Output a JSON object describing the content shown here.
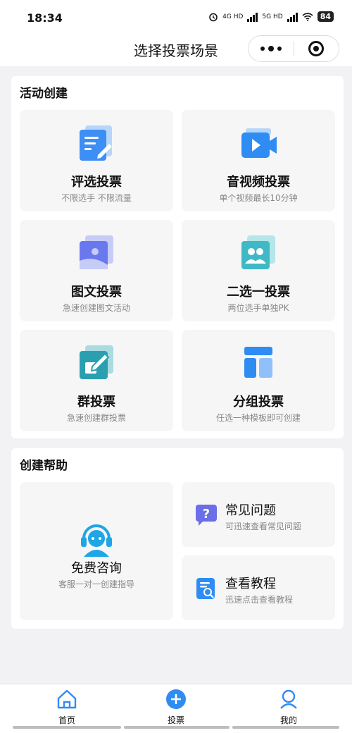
{
  "status": {
    "time": "18:34",
    "net1": "4G HD",
    "net2": "5G HD",
    "battery": "84"
  },
  "nav": {
    "title": "选择投票场景",
    "more_icon": "more-dots-icon",
    "close_icon": "target-circle-icon"
  },
  "create": {
    "title": "活动创建",
    "cards": [
      {
        "title": "评选投票",
        "sub": "不限选手 不限流量",
        "icon": "document-edit-icon"
      },
      {
        "title": "音视频投票",
        "sub": "单个视频最长10分钟",
        "icon": "video-camera-icon"
      },
      {
        "title": "图文投票",
        "sub": "急速创建图文活动",
        "icon": "image-icon"
      },
      {
        "title": "二选一投票",
        "sub": "两位选手单独PK",
        "icon": "two-users-icon"
      },
      {
        "title": "群投票",
        "sub": "急速创建群投票",
        "icon": "group-edit-icon"
      },
      {
        "title": "分组投票",
        "sub": "任选一种模板即可创建",
        "icon": "layout-grid-icon"
      }
    ]
  },
  "help": {
    "title": "创建帮助",
    "consult": {
      "title": "免费咨询",
      "sub": "客服一对一创建指导",
      "icon": "headset-icon"
    },
    "faq": {
      "title": "常见问题",
      "sub": "可迅速查看常见问题",
      "icon": "question-bubble-icon"
    },
    "tutorial": {
      "title": "查看教程",
      "sub": "迅速点击查看教程",
      "icon": "search-doc-icon"
    }
  },
  "tabs": [
    {
      "label": "首页",
      "icon": "home-icon"
    },
    {
      "label": "投票",
      "icon": "plus-circle-icon"
    },
    {
      "label": "我的",
      "icon": "user-icon"
    }
  ],
  "colors": {
    "primary": "#2f8cf3",
    "bg": "#f2f2f4",
    "card": "#f6f6f7"
  }
}
